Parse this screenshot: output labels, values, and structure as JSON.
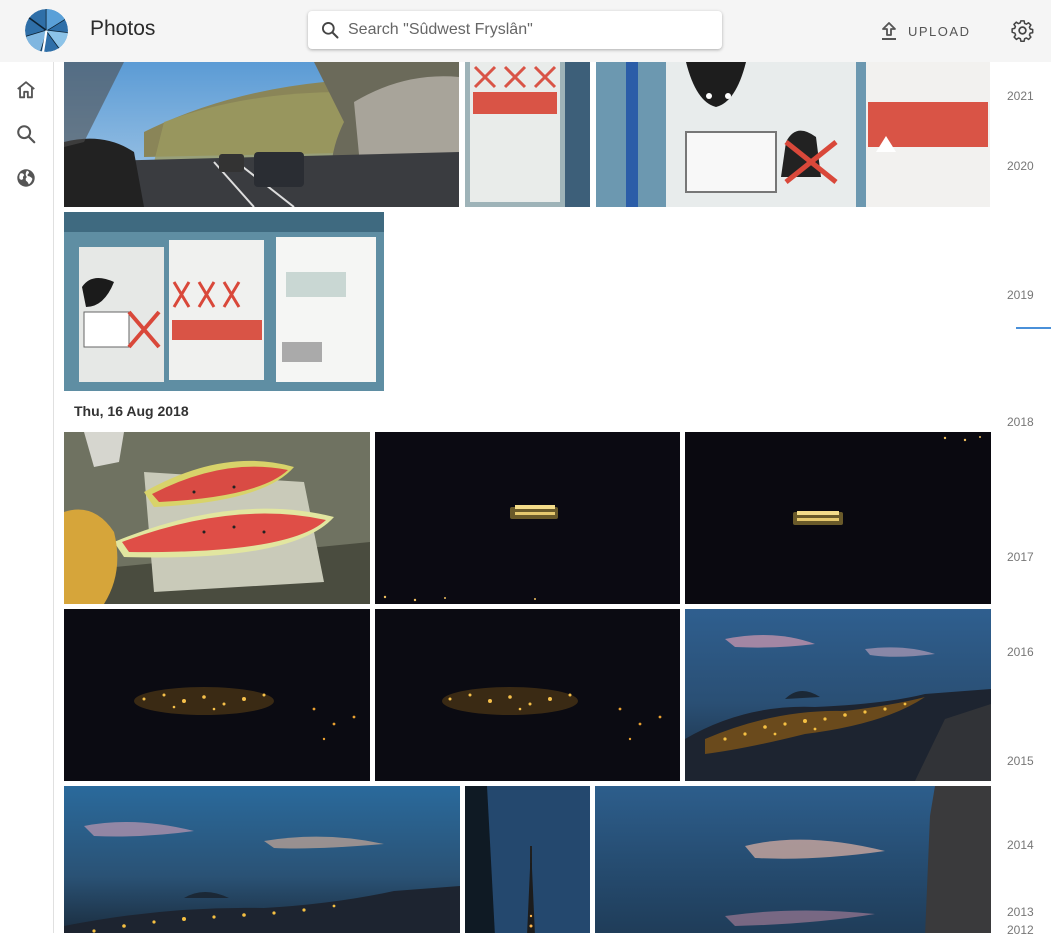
{
  "app": {
    "title": "Photos"
  },
  "search": {
    "placeholder": "Search \"Sûdwest Fryslân\""
  },
  "header": {
    "upload_label": "UPLOAD"
  },
  "sidebar": {
    "items": [
      {
        "icon": "home-icon"
      },
      {
        "icon": "search-icon"
      },
      {
        "icon": "globe-icon"
      }
    ]
  },
  "sections": [
    {
      "date": "Thu, 16 Aug 2018"
    }
  ],
  "timeline": {
    "years": [
      "2021",
      "2020",
      "2019",
      "2018",
      "2017",
      "2016",
      "2015",
      "2014",
      "2013",
      "2012"
    ]
  },
  "colors": {
    "accent": "#4a90d9",
    "topbar": "#f5f5f5"
  }
}
